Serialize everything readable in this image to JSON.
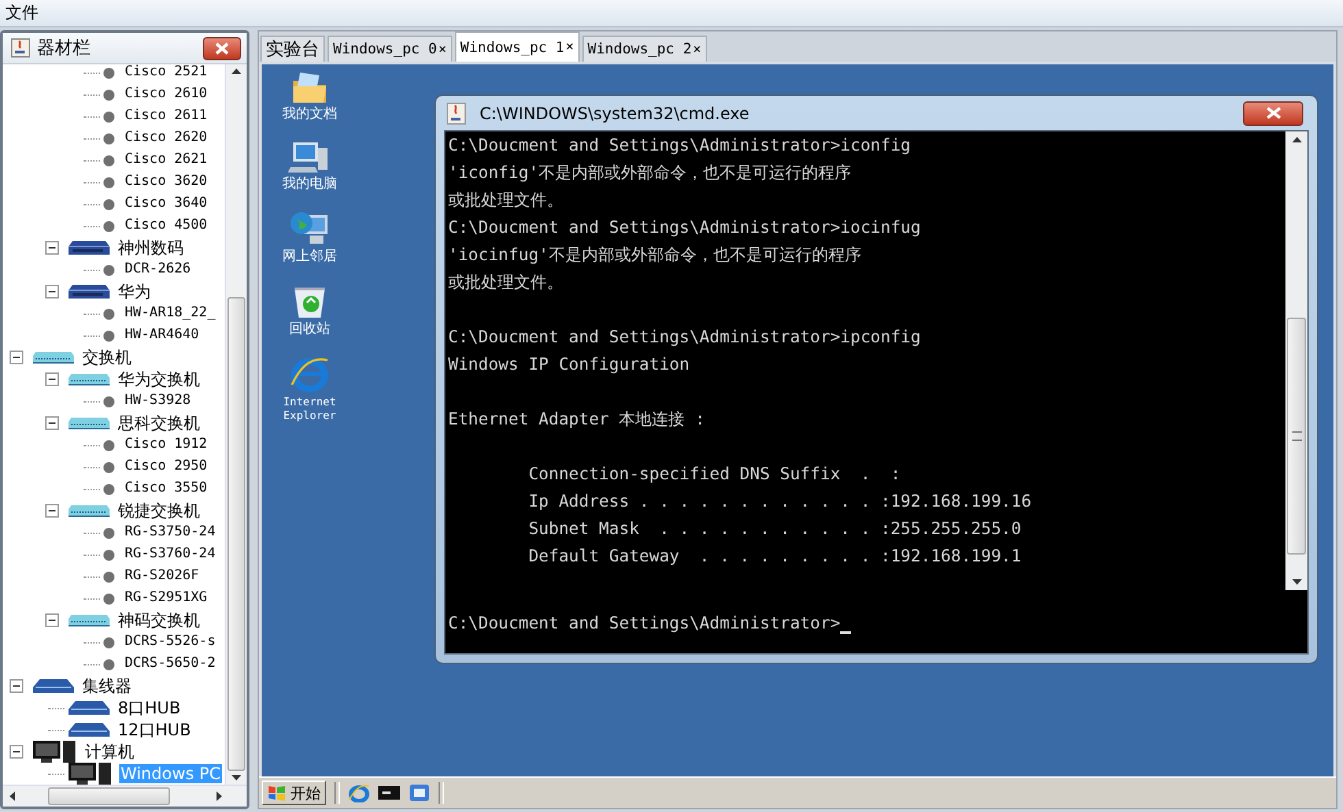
{
  "menu_bar": {
    "items": [
      "文件"
    ]
  },
  "equipment_panel": {
    "title": "器材栏",
    "tree": [
      {
        "children": [
          {
            "children": [
              {
                "label": "Cisco 2521",
                "kind": "device",
                "selected": false
              },
              {
                "label": "Cisco 2610",
                "kind": "device",
                "selected": false
              },
              {
                "label": "Cisco 2611",
                "kind": "device",
                "selected": false
              },
              {
                "label": "Cisco 2620",
                "kind": "device",
                "selected": false
              },
              {
                "label": "Cisco 2621",
                "kind": "device",
                "selected": false
              },
              {
                "label": "Cisco 3620",
                "kind": "device",
                "selected": false
              },
              {
                "label": "Cisco 3640",
                "kind": "device",
                "selected": false
              },
              {
                "label": "Cisco 4500",
                "kind": "device",
                "selected": false
              }
            ]
          },
          {
            "label": "神州数码",
            "kind": "router",
            "expanded": true,
            "selected": false,
            "children": [
              {
                "label": "DCR-2626",
                "kind": "device",
                "selected": false
              }
            ]
          },
          {
            "label": "华为",
            "kind": "router",
            "expanded": true,
            "selected": false,
            "children": [
              {
                "label": "HW-AR18_22_",
                "kind": "device",
                "selected": false
              },
              {
                "label": "HW-AR4640",
                "kind": "device",
                "selected": false
              }
            ]
          }
        ]
      },
      {
        "label": "交换机",
        "kind": "switch",
        "expanded": true,
        "selected": false,
        "children": [
          {
            "label": "华为交换机",
            "kind": "switch",
            "expanded": true,
            "selected": false,
            "children": [
              {
                "label": "HW-S3928",
                "kind": "device",
                "selected": false
              }
            ]
          },
          {
            "label": "思科交换机",
            "kind": "switch",
            "expanded": true,
            "selected": false,
            "children": [
              {
                "label": "Cisco 1912",
                "kind": "device",
                "selected": false
              },
              {
                "label": "Cisco 2950",
                "kind": "device",
                "selected": false
              },
              {
                "label": "Cisco 3550",
                "kind": "device",
                "selected": false
              }
            ]
          },
          {
            "label": "锐捷交换机",
            "kind": "switch",
            "expanded": true,
            "selected": false,
            "children": [
              {
                "label": "RG-S3750-24",
                "kind": "device",
                "selected": false
              },
              {
                "label": "RG-S3760-24",
                "kind": "device",
                "selected": false
              },
              {
                "label": "RG-S2026F",
                "kind": "device",
                "selected": false
              },
              {
                "label": "RG-S2951XG",
                "kind": "device",
                "selected": false
              }
            ]
          },
          {
            "label": "神码交换机",
            "kind": "switch",
            "expanded": true,
            "selected": false,
            "children": [
              {
                "label": "DCRS-5526-s",
                "kind": "device",
                "selected": false
              },
              {
                "label": "DCRS-5650-2",
                "kind": "device",
                "selected": false
              }
            ]
          }
        ]
      },
      {
        "label": "集线器",
        "kind": "hub",
        "expanded": true,
        "selected": false,
        "children": [
          {
            "label": "8口HUB",
            "kind": "hub",
            "selected": false
          },
          {
            "label": "12口HUB",
            "kind": "hub",
            "selected": false
          }
        ]
      },
      {
        "label": "计算机",
        "kind": "pc",
        "expanded": true,
        "selected": false,
        "children": [
          {
            "label": "Windows PC",
            "kind": "pc",
            "selected": true
          }
        ]
      }
    ]
  },
  "tabs": [
    {
      "label": "实验台",
      "selected": false
    },
    {
      "label": "Windows_pc 0",
      "close": "×",
      "selected": false
    },
    {
      "label": "Windows_pc 1",
      "close": "×",
      "selected": true
    },
    {
      "label": "Windows_pc 2",
      "close": "×",
      "selected": false
    }
  ],
  "desktop_icons": [
    {
      "label": "我的文档",
      "kind": "documents"
    },
    {
      "label": "我的电脑",
      "kind": "computer"
    },
    {
      "label": "网上邻居",
      "kind": "network"
    },
    {
      "label": "回收站",
      "kind": "recycle"
    },
    {
      "label": "Internet Explorer",
      "kind": "browser"
    }
  ],
  "cmd_window": {
    "title": "C:\\WINDOWS\\system32\\cmd.exe",
    "output_blocks": [
      {
        "lines": [
          "C:\\Doucment and Settings\\Administrator>iconfig",
          "'iconfig'不是内部或外部命令，也不是可运行的程序",
          "或批处理文件。",
          "C:\\Doucment and Settings\\Administrator>iocinfug",
          "'iocinfug'不是内部或外部命令，也不是可运行的程序",
          "或批处理文件。"
        ]
      },
      {
        "lines": [
          "C:\\Doucment and Settings\\Administrator>ipconfig",
          "Windows IP Configuration"
        ]
      },
      {
        "lines": [
          "Ethernet Adapter 本地连接 :"
        ]
      },
      {
        "lines": [
          "        Connection-specified DNS Suffix  .  :",
          "        Ip Address . . . . . . . . . . . . :192.168.199.16",
          "        Subnet Mask  . . . . . . . . . . . :255.255.255.0",
          "        Default Gateway  . . . . . . . . . :192.168.199.1"
        ]
      }
    ],
    "prompt": "C:\\Doucment and Settings\\Administrator>"
  },
  "taskbar": {
    "start_label": "开始",
    "quick_launch": [
      {
        "kind": "browser"
      },
      {
        "kind": "terminal"
      },
      {
        "kind": "desktop"
      }
    ]
  }
}
